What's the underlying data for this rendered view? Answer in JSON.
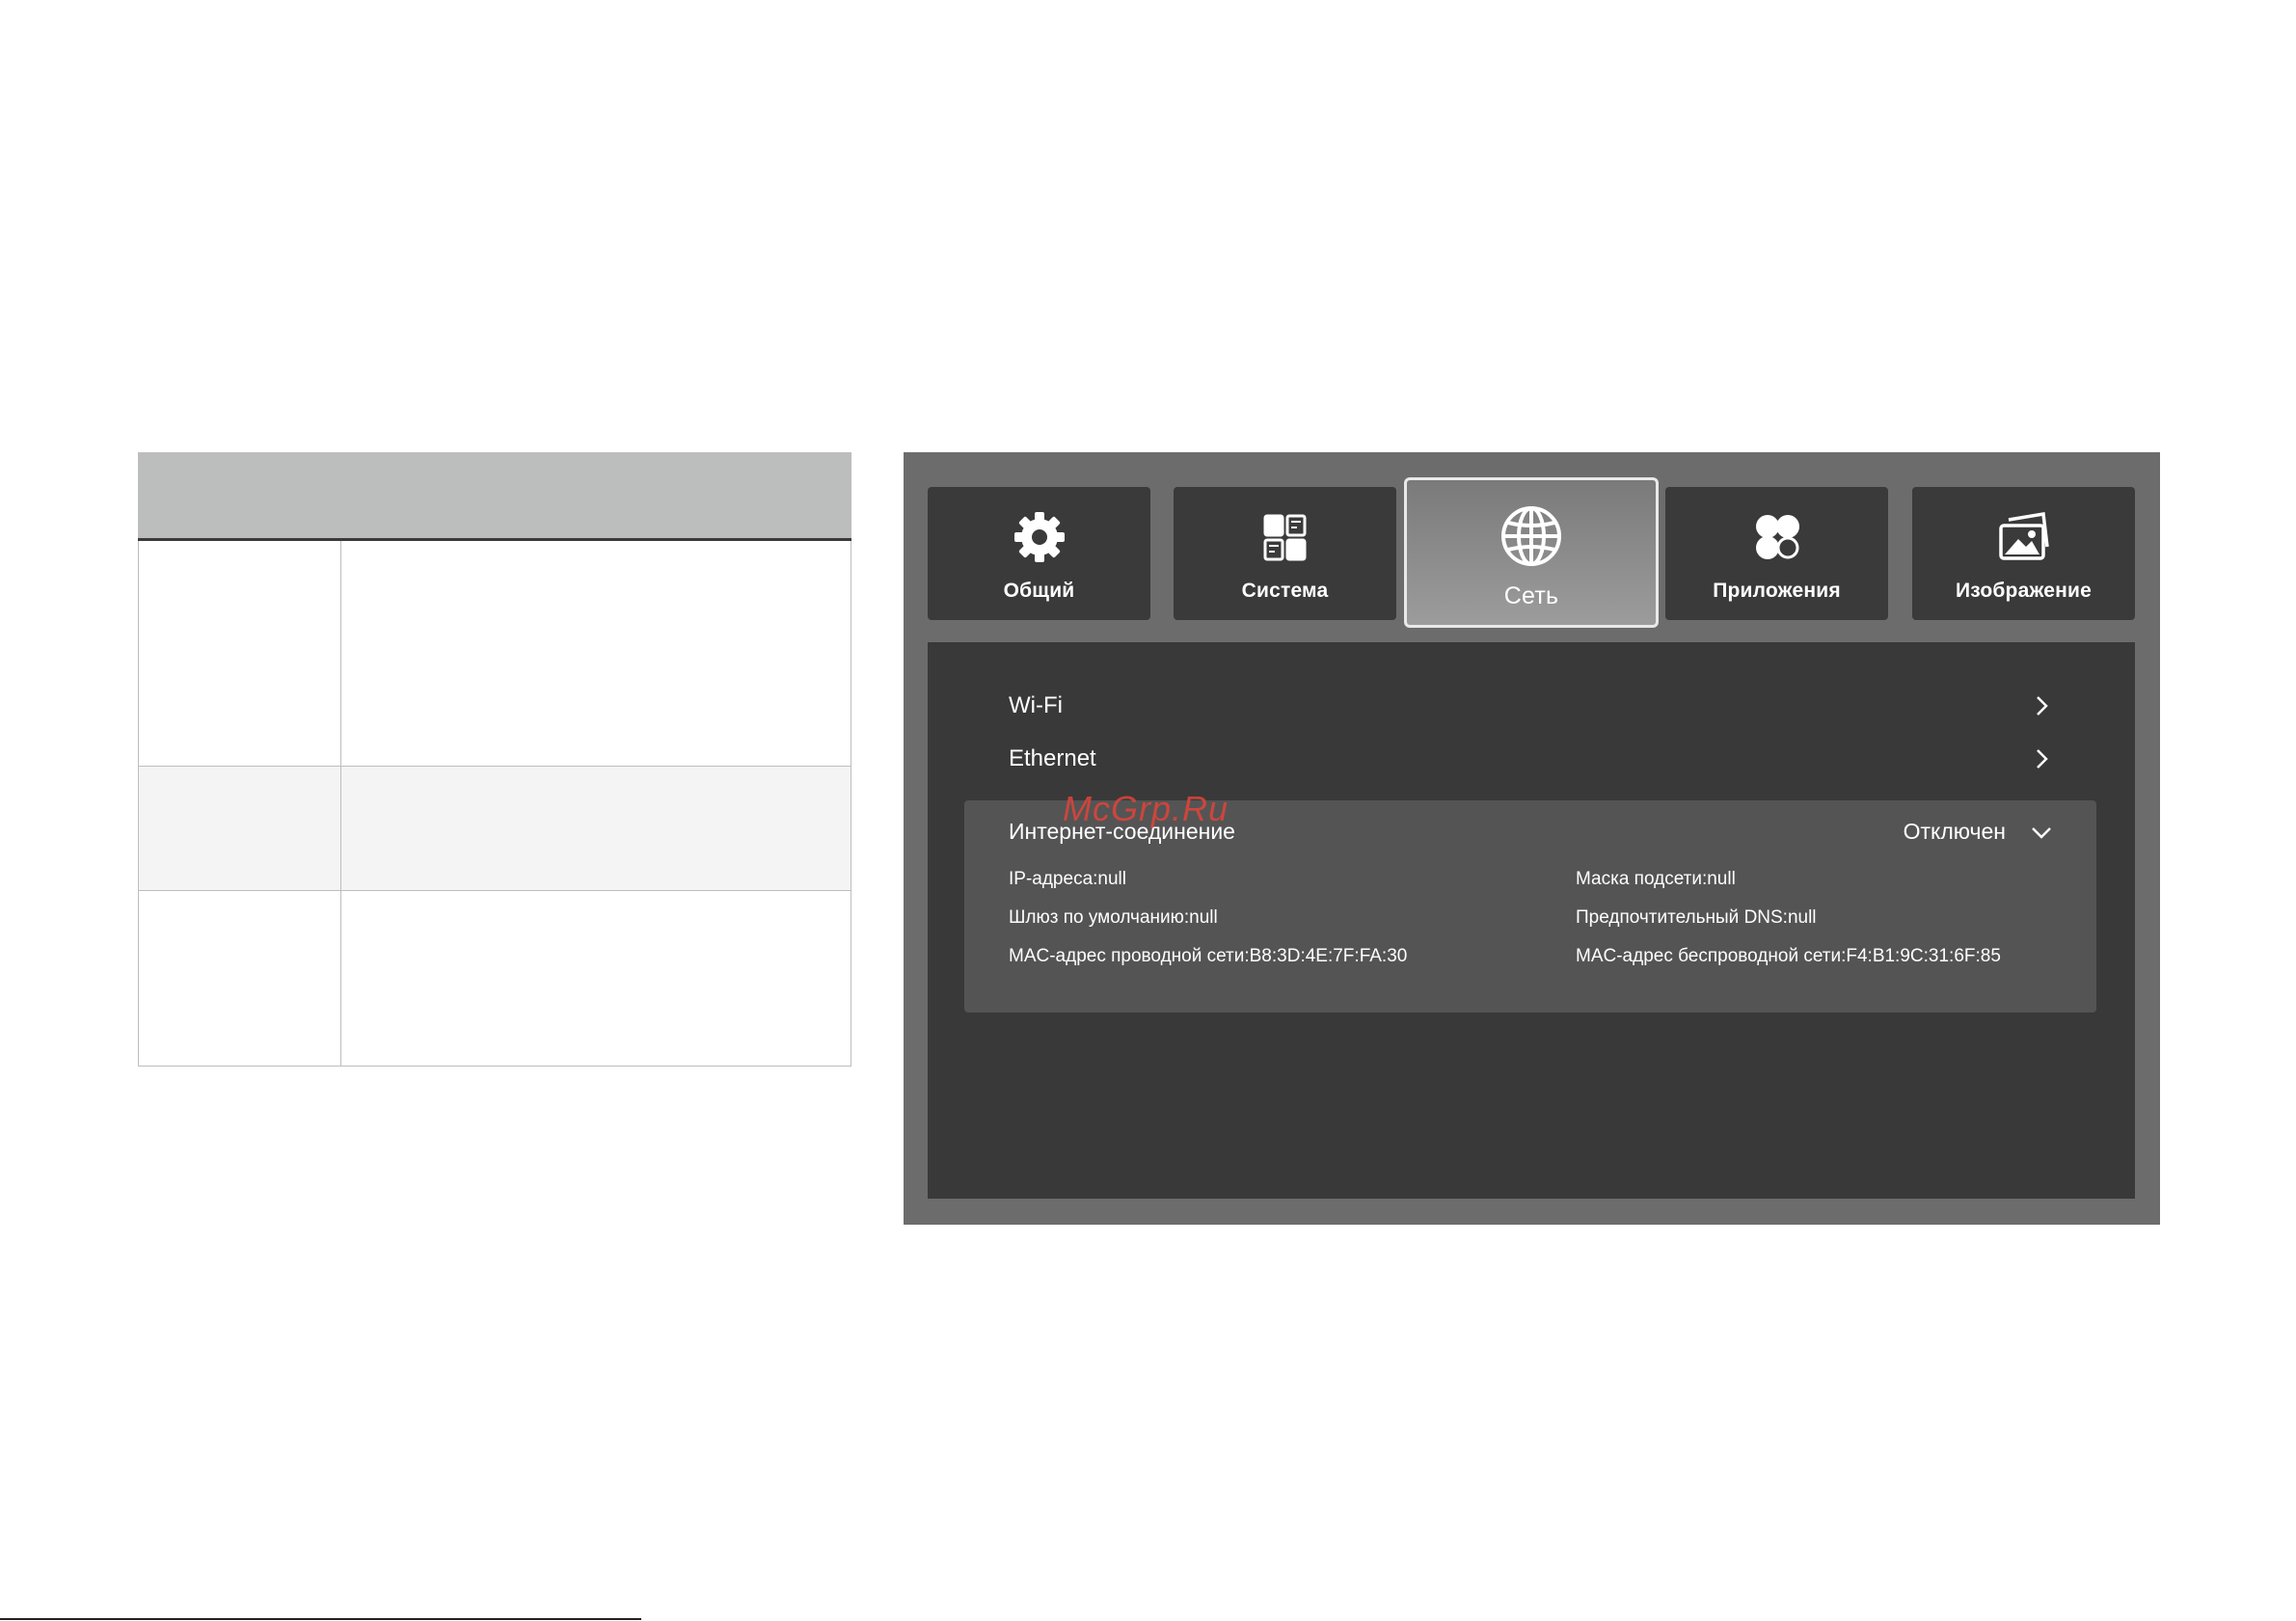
{
  "watermark": "McGrp.Ru",
  "tabs": [
    {
      "label": "Общий",
      "icon": "gear-icon"
    },
    {
      "label": "Система",
      "icon": "system-grid-icon"
    },
    {
      "label": "Сеть",
      "icon": "globe-icon",
      "active": true
    },
    {
      "label": "Приложения",
      "icon": "apps-icon"
    },
    {
      "label": "Изображение",
      "icon": "image-icon"
    }
  ],
  "menu": {
    "wifi": "Wi-Fi",
    "ethernet": "Ethernet"
  },
  "connection": {
    "title": "Интернет-соединение",
    "status": "Отключен",
    "ip": "IP-адреса:null",
    "mask": "Маска подсети:null",
    "gateway": "Шлюз по умолчанию:null",
    "dns": "Предпочтительный DNS:null",
    "mac_wired": "MAC-адрес проводной сети:B8:3D:4E:7F:FA:30",
    "mac_wireless": "MAC-адрес беспроводной сети:F4:B1:9C:31:6F:85"
  },
  "colors": {
    "frame": "#6c6c6c",
    "panel": "#393939",
    "card": "#545454",
    "tab": "#3a3a3a",
    "watermark": "#e0443a"
  }
}
